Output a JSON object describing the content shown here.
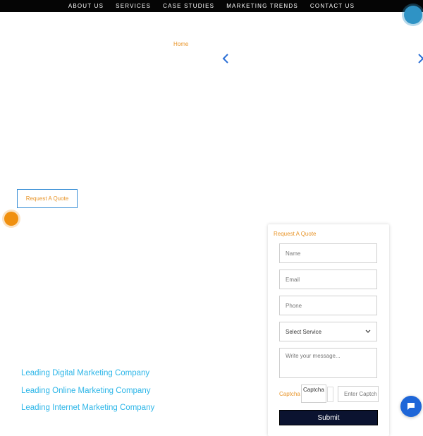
{
  "nav": {
    "items": [
      "ABOUT US",
      "SERVICES",
      "CASE STUDIES",
      "MARKETING TRENDS",
      "CONTACT US"
    ]
  },
  "breadcrumb": {
    "home": "Home"
  },
  "hero": {
    "quote_button": "Request A Quote"
  },
  "links": {
    "items": [
      "Leading Digital Marketing Company",
      "Leading Online Marketing Company",
      "Leading Internet Marketing Company"
    ]
  },
  "form": {
    "title": "Request A Quote",
    "name_placeholder": "Name",
    "email_placeholder": "Email",
    "phone_placeholder": "Phone",
    "service_selected": "Select Service",
    "message_placeholder": "Write your message...",
    "captcha_label": "Captcha",
    "captcha_image_alt": "Captcha",
    "captcha_input_placeholder": "Enter Captch",
    "submit_label": "Submit"
  },
  "colors": {
    "nav_bg": "#050505",
    "accent_orange": "#e8952a",
    "accent_blue": "#3a8fd6",
    "link_blue": "#2db6e8",
    "submit_bg": "#0b1330",
    "chat_bg": "#1e66d8"
  },
  "icons": {
    "prev": "chevron-left-icon",
    "next": "chevron-right-icon",
    "chat": "chat-icon",
    "dropdown": "chevron-down-icon"
  }
}
